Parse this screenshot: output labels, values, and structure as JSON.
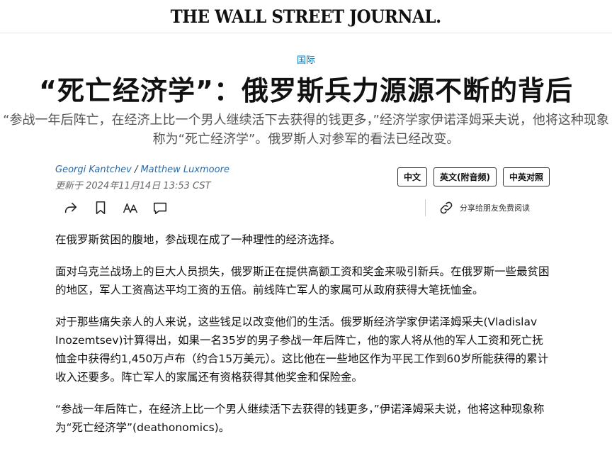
{
  "masthead": {
    "logo": "THE WALL STREET JOURNAL."
  },
  "article": {
    "section": "国际",
    "headline": "“死亡经济学”：俄罗斯兵力源源不断的背后",
    "dek": "“参战一年后阵亡，在经济上比一个男人继续活下去获得的钱更多，”经济学家伊诺泽姆采夫说，他将这种现象称为“死亡经济学”。俄罗斯人对参军的看法已经改变。",
    "authors": [
      "Georgi Kantchev",
      "Matthew Luxmoore"
    ],
    "author_separator": " / ",
    "updated": "更新于 2024年11月14日 13:53 CST",
    "paragraphs": [
      "在俄罗斯贫困的腹地，参战现在成了一种理性的经济选择。",
      "面对乌克兰战场上的巨大人员损失，俄罗斯正在提供高额工资和奖金来吸引新兵。在俄罗斯一些最贫困的地区，军人工资高达平均工资的五倍。前线阵亡军人的家属可从政府获得大笔抚恤金。",
      "对于那些痛失亲人的人来说，这些钱足以改变他们的生活。俄罗斯经济学家伊诺泽姆采夫(Vladislav Inozemtsev)计算得出，如果一名35岁的男子参战一年后阵亡，他的家人将从他的军人工资和死亡抚恤金中获得约1,450万卢布（约合15万美元）。这比他在一些地区作为平民工作到60岁所能获得的累计收入还要多。阵亡军人的家属还有资格获得其他奖金和保险金。",
      "“参战一年后阵亡，在经济上比一个男人继续活下去获得的钱更多，”伊诺泽姆采夫说，他将这种现象称为“死亡经济学”(deathonomics)。"
    ]
  },
  "language_buttons": [
    "中文",
    "英文(附音频)",
    "中英对照"
  ],
  "toolbar": {
    "icons": [
      "share-icon",
      "bookmark-icon",
      "text-size-icon",
      "comment-icon"
    ],
    "gift_label": "分享给朋友免费阅读",
    "gift_icon": "link-icon"
  },
  "colors": {
    "section": "#0274b6",
    "byline": "#2b6aa6",
    "dek": "#555555"
  }
}
